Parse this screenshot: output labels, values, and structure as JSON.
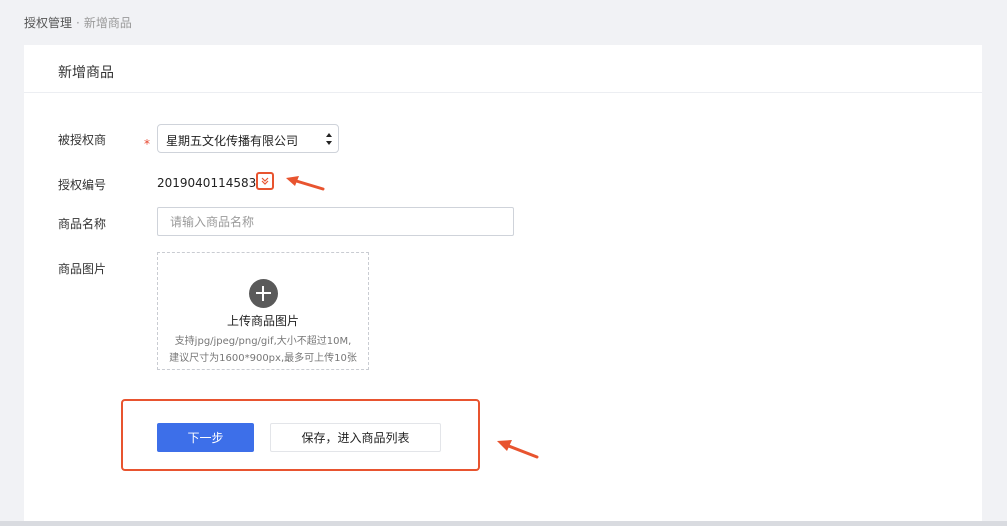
{
  "breadcrumb": {
    "parent": "授权管理",
    "separator": "·",
    "current": "新增商品"
  },
  "card": {
    "title": "新增商品"
  },
  "form": {
    "licensee": {
      "label": "被授权商",
      "required_mark": "*",
      "selected": "星期五文化传播有限公司"
    },
    "auth_code": {
      "label": "授权编号",
      "value": "20190401145832"
    },
    "product_name": {
      "label": "商品名称",
      "placeholder": "请输入商品名称",
      "value": ""
    },
    "product_image": {
      "label": "商品图片",
      "upload_title": "上传商品图片",
      "hint_line1": "支持jpg/jpeg/png/gif,大小不超过10M,",
      "hint_line2": "建议尺寸为1600*900px,最多可上传10张"
    }
  },
  "actions": {
    "next_label": "下一步",
    "save_label": "保存，进入商品列表"
  },
  "colors": {
    "primary": "#3d6fe9",
    "annotation": "#e8542f",
    "required": "#e8462f"
  },
  "icons": {
    "expand": "chevrons-down-icon",
    "upload": "plus-circle-icon",
    "select_arrows": "updown-arrows-icon"
  }
}
